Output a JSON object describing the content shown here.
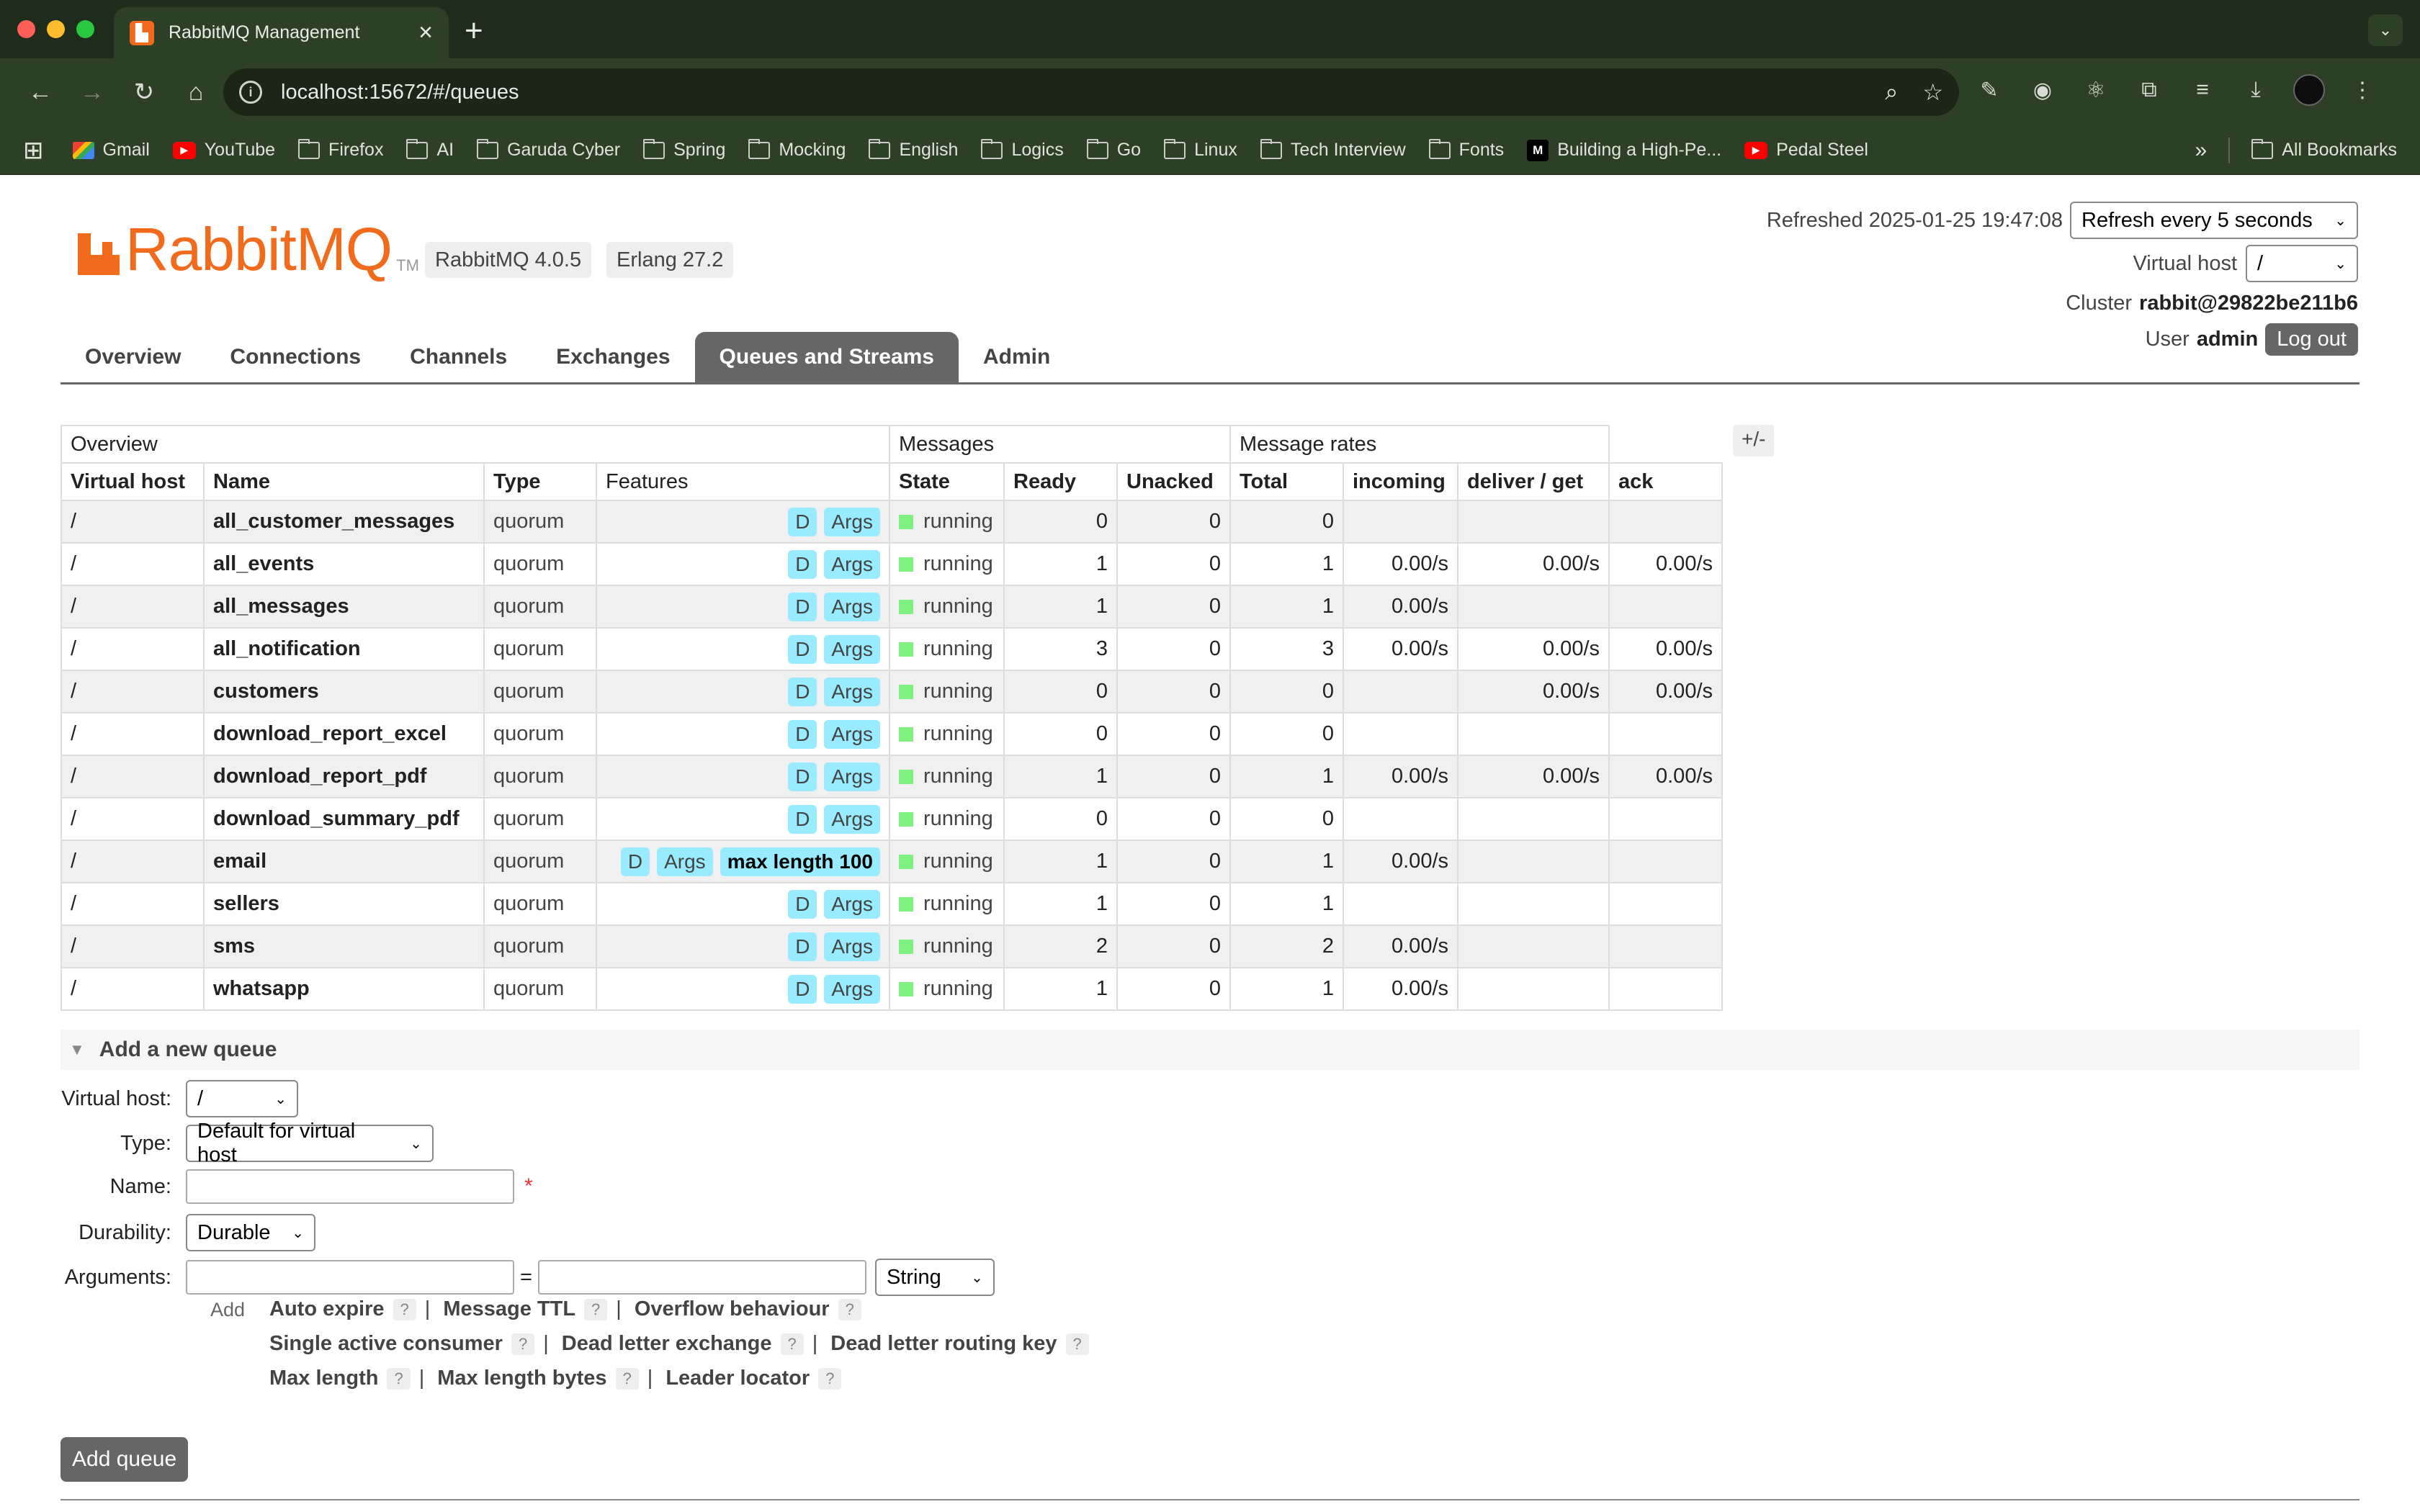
{
  "browser": {
    "tab_title": "RabbitMQ Management",
    "url": "localhost:15672/#/queues",
    "bookmarks": [
      "Gmail",
      "YouTube",
      "Firefox",
      "AI",
      "Garuda Cyber",
      "Spring",
      "Mocking",
      "English",
      "Logics",
      "Go",
      "Linux",
      "Tech Interview",
      "Fonts",
      "Building a High-Pe...",
      "Pedal Steel"
    ],
    "all_bookmarks": "All Bookmarks"
  },
  "header": {
    "logo_text": "RabbitMQ",
    "logo_tm": "TM",
    "version": "RabbitMQ 4.0.5",
    "erlang": "Erlang 27.2",
    "refreshed_label": "Refreshed 2025-01-25 19:47:08",
    "refresh_select": "Refresh every 5 seconds",
    "vhost_label": "Virtual host",
    "vhost_value": "/",
    "cluster_label": "Cluster",
    "cluster_value": "rabbit@29822be211b6",
    "user_label": "User",
    "user_value": "admin",
    "logout": "Log out"
  },
  "nav": {
    "tabs": [
      "Overview",
      "Connections",
      "Channels",
      "Exchanges",
      "Queues and Streams",
      "Admin"
    ],
    "active": "Queues and Streams"
  },
  "queues": {
    "group_headers": {
      "overview": "Overview",
      "messages": "Messages",
      "rates": "Message rates"
    },
    "columns": [
      "Virtual host",
      "Name",
      "Type",
      "Features",
      "State",
      "Ready",
      "Unacked",
      "Total",
      "incoming",
      "deliver / get",
      "ack"
    ],
    "plusminus": "+/-",
    "rows": [
      {
        "vhost": "/",
        "name": "all_customer_messages",
        "type": "quorum",
        "features": [
          "D",
          "Args"
        ],
        "state": "running",
        "ready": "0",
        "unacked": "0",
        "total": "0",
        "incoming": "",
        "deliver": "",
        "ack": ""
      },
      {
        "vhost": "/",
        "name": "all_events",
        "type": "quorum",
        "features": [
          "D",
          "Args"
        ],
        "state": "running",
        "ready": "1",
        "unacked": "0",
        "total": "1",
        "incoming": "0.00/s",
        "deliver": "0.00/s",
        "ack": "0.00/s"
      },
      {
        "vhost": "/",
        "name": "all_messages",
        "type": "quorum",
        "features": [
          "D",
          "Args"
        ],
        "state": "running",
        "ready": "1",
        "unacked": "0",
        "total": "1",
        "incoming": "0.00/s",
        "deliver": "",
        "ack": ""
      },
      {
        "vhost": "/",
        "name": "all_notification",
        "type": "quorum",
        "features": [
          "D",
          "Args"
        ],
        "state": "running",
        "ready": "3",
        "unacked": "0",
        "total": "3",
        "incoming": "0.00/s",
        "deliver": "0.00/s",
        "ack": "0.00/s"
      },
      {
        "vhost": "/",
        "name": "customers",
        "type": "quorum",
        "features": [
          "D",
          "Args"
        ],
        "state": "running",
        "ready": "0",
        "unacked": "0",
        "total": "0",
        "incoming": "",
        "deliver": "0.00/s",
        "ack": "0.00/s"
      },
      {
        "vhost": "/",
        "name": "download_report_excel",
        "type": "quorum",
        "features": [
          "D",
          "Args"
        ],
        "state": "running",
        "ready": "0",
        "unacked": "0",
        "total": "0",
        "incoming": "",
        "deliver": "",
        "ack": ""
      },
      {
        "vhost": "/",
        "name": "download_report_pdf",
        "type": "quorum",
        "features": [
          "D",
          "Args"
        ],
        "state": "running",
        "ready": "1",
        "unacked": "0",
        "total": "1",
        "incoming": "0.00/s",
        "deliver": "0.00/s",
        "ack": "0.00/s"
      },
      {
        "vhost": "/",
        "name": "download_summary_pdf",
        "type": "quorum",
        "features": [
          "D",
          "Args"
        ],
        "state": "running",
        "ready": "0",
        "unacked": "0",
        "total": "0",
        "incoming": "",
        "deliver": "",
        "ack": ""
      },
      {
        "vhost": "/",
        "name": "email",
        "type": "quorum",
        "features": [
          "D",
          "Args",
          "max length 100"
        ],
        "state": "running",
        "ready": "1",
        "unacked": "0",
        "total": "1",
        "incoming": "0.00/s",
        "deliver": "",
        "ack": ""
      },
      {
        "vhost": "/",
        "name": "sellers",
        "type": "quorum",
        "features": [
          "D",
          "Args"
        ],
        "state": "running",
        "ready": "1",
        "unacked": "0",
        "total": "1",
        "incoming": "",
        "deliver": "",
        "ack": ""
      },
      {
        "vhost": "/",
        "name": "sms",
        "type": "quorum",
        "features": [
          "D",
          "Args"
        ],
        "state": "running",
        "ready": "2",
        "unacked": "0",
        "total": "2",
        "incoming": "0.00/s",
        "deliver": "",
        "ack": ""
      },
      {
        "vhost": "/",
        "name": "whatsapp",
        "type": "quorum",
        "features": [
          "D",
          "Args"
        ],
        "state": "running",
        "ready": "1",
        "unacked": "0",
        "total": "1",
        "incoming": "0.00/s",
        "deliver": "",
        "ack": ""
      }
    ]
  },
  "add_queue": {
    "section_title": "Add a new queue",
    "labels": {
      "vhost": "Virtual host:",
      "type": "Type:",
      "name": "Name:",
      "durability": "Durability:",
      "arguments": "Arguments:"
    },
    "vhost_value": "/",
    "type_value": "Default for virtual host",
    "name_value": "",
    "required_mark": "*",
    "durability_value": "Durable",
    "arg_key": "",
    "arg_value": "",
    "arg_eq": "=",
    "arg_type": "String",
    "add_label": "Add",
    "helpers": [
      [
        "Auto expire",
        "Message TTL",
        "Overflow behaviour"
      ],
      [
        "Single active consumer",
        "Dead letter exchange",
        "Dead letter routing key"
      ],
      [
        "Max length",
        "Max length bytes",
        "Leader locator"
      ]
    ],
    "help_mark": "?",
    "sep": "|",
    "submit": "Add queue"
  },
  "colors": {
    "brand": "#f26b1d",
    "feature_badge": "#99ebff",
    "running": "#80f080",
    "nav_active": "#666666"
  }
}
